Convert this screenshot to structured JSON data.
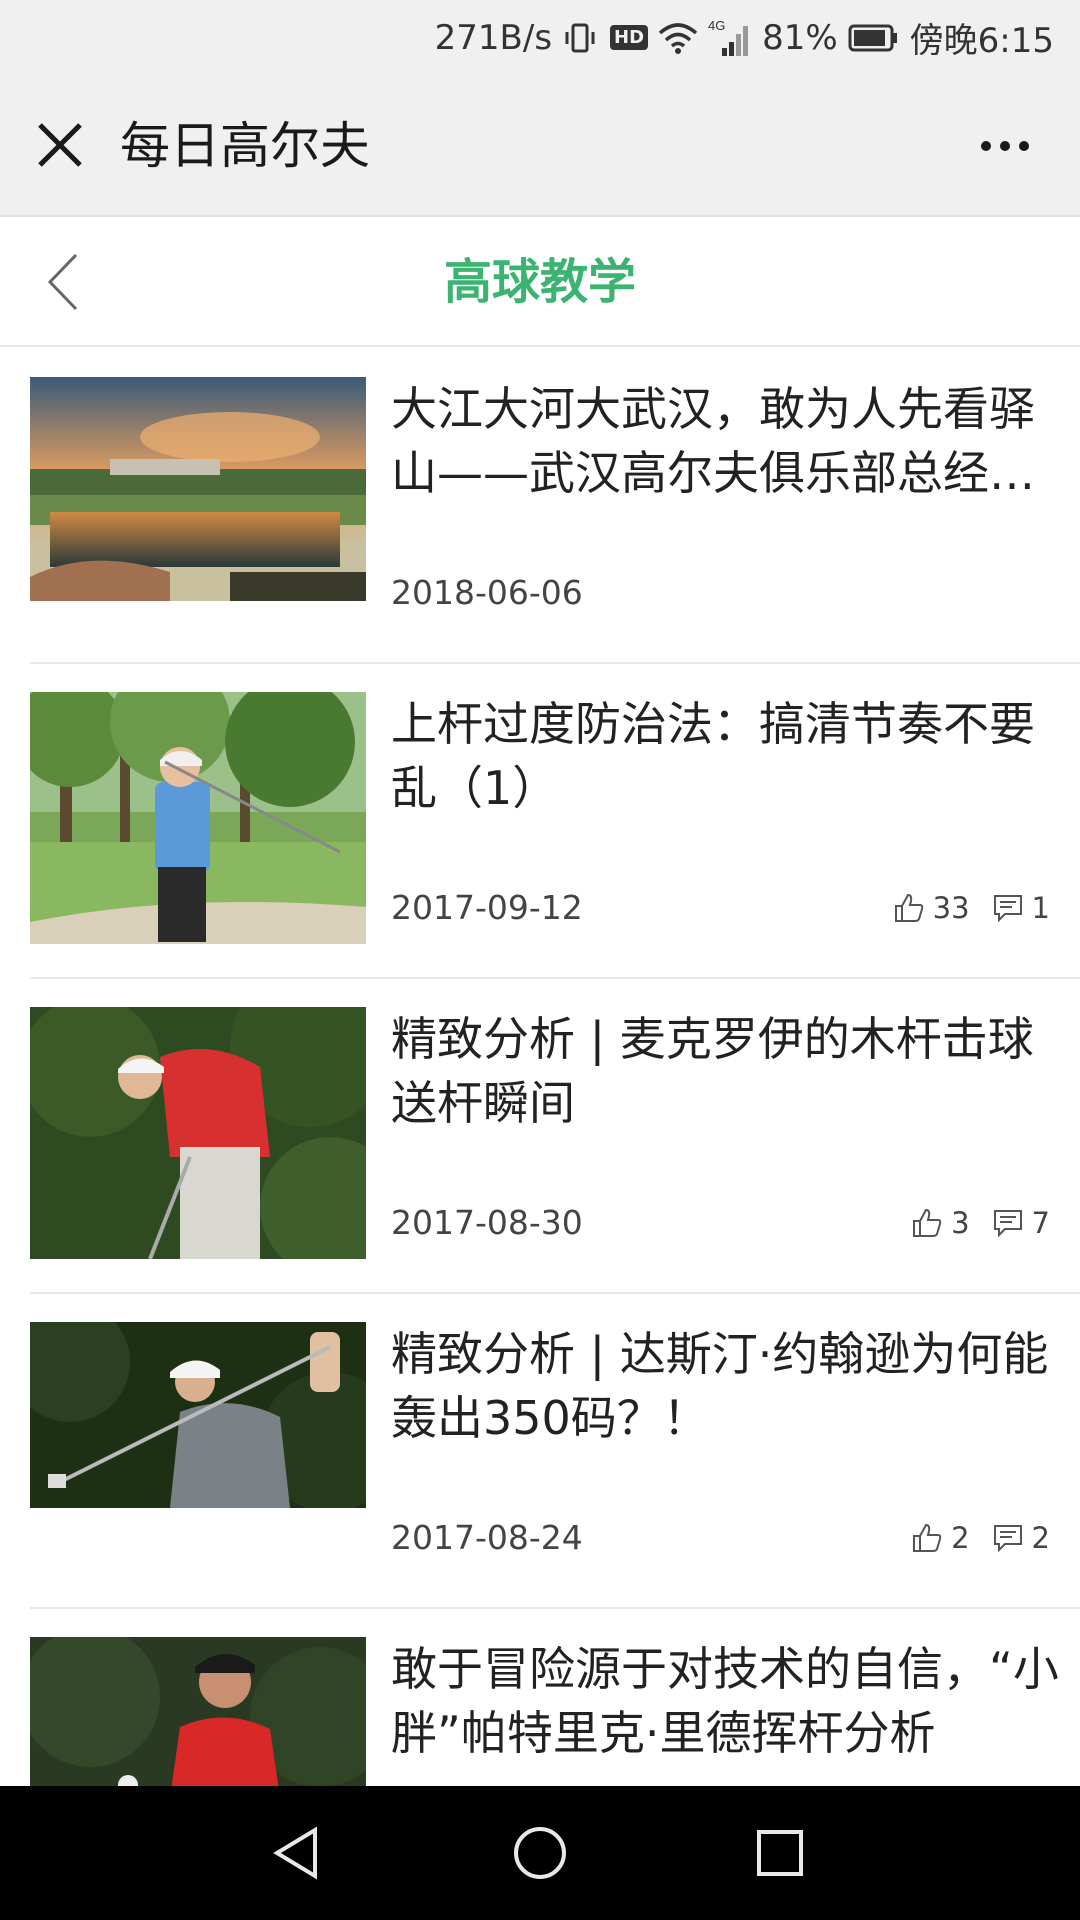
{
  "status_bar": {
    "speed": "271B/s",
    "hd": "HD",
    "network": "4G",
    "battery": "81%",
    "time": "傍晚6:15"
  },
  "app_header": {
    "title": "每日高尔夫"
  },
  "sub_header": {
    "title": "高球教学"
  },
  "articles": [
    {
      "title": "大江大河大武汉，敢为人先看驿山——武汉高尔夫俱乐部总经理…",
      "date": "2018-06-06",
      "likes": "",
      "comments": ""
    },
    {
      "title": "上杆过度防治法：搞清节奏不要乱（1）",
      "date": "2017-09-12",
      "likes": "33",
      "comments": "1"
    },
    {
      "title": "精致分析 | 麦克罗伊的木杆击球送杆瞬间",
      "date": "2017-08-30",
      "likes": "3",
      "comments": "7"
    },
    {
      "title": "精致分析 | 达斯汀·约翰逊为何能轰出350码？！",
      "date": "2017-08-24",
      "likes": "2",
      "comments": "2"
    },
    {
      "title": "敢于冒险源于对技术的自信，“小胖”帕特里克·里德挥杆分析",
      "date": "",
      "likes": "",
      "comments": ""
    }
  ],
  "colors": {
    "accent": "#3cb371",
    "header_bg": "#f0f0f0",
    "nav_bg": "#000000"
  }
}
